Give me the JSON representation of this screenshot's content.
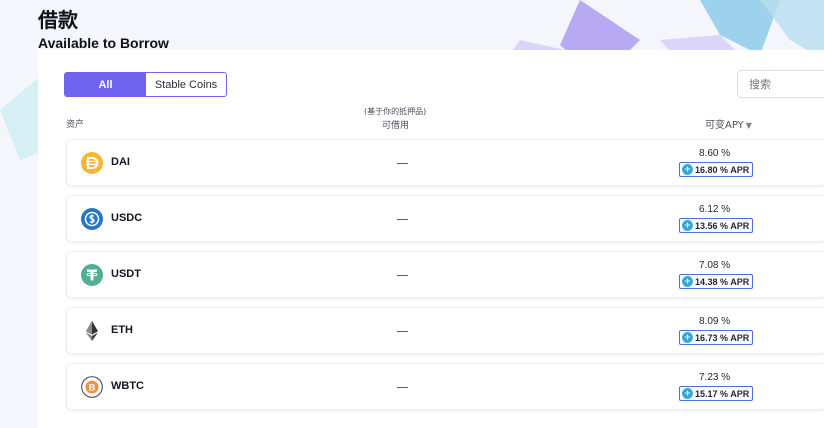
{
  "page": {
    "title_zh": "借款",
    "title_en": "Available to Borrow"
  },
  "filters": {
    "all_label": "All",
    "stable_label": "Stable Coins",
    "search_placeholder": "搜索"
  },
  "table_header": {
    "asset": "资产",
    "borrow_note": "(基于你的抵押品)",
    "borrow": "可借用",
    "apy": "可变APY",
    "sort_caret": "▼"
  },
  "rows": [
    {
      "symbol": "DAI",
      "available": "—",
      "apy": "8.60 %",
      "apr": "16.80 % APR",
      "icon": "dai-icon",
      "color": "#F4B731"
    },
    {
      "symbol": "USDC",
      "available": "—",
      "apy": "6.12 %",
      "apr": "13.56 % APR",
      "icon": "usdc-icon",
      "color": "#2775CA"
    },
    {
      "symbol": "USDT",
      "available": "—",
      "apy": "7.08 %",
      "apr": "14.38 % APR",
      "icon": "usdt-icon",
      "color": "#50AF95"
    },
    {
      "symbol": "ETH",
      "available": "—",
      "apy": "8.09 %",
      "apr": "16.73 % APR",
      "icon": "eth-icon",
      "color": "#343434"
    },
    {
      "symbol": "WBTC",
      "available": "—",
      "apy": "7.23 %",
      "apr": "15.17 % APR",
      "icon": "wbtc-icon",
      "color": "#F09242"
    }
  ],
  "colors": {
    "accent": "#6f63f0",
    "background": "#f4f6fc",
    "apr_badge_border": "#4f6fd8"
  }
}
